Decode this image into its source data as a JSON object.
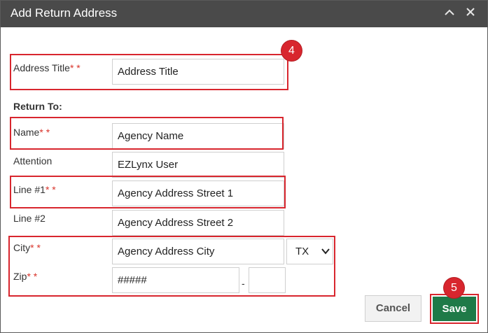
{
  "dialog": {
    "title": "Add Return Address",
    "collapse_icon": "chevron-up-icon",
    "close_icon": "close-icon"
  },
  "form": {
    "address_title": {
      "label": "Address Title",
      "required_mark": "* *",
      "value": "Address Title"
    },
    "section_label": "Return To:",
    "name": {
      "label": "Name",
      "required_mark": "* *",
      "value": "Agency Name"
    },
    "attention": {
      "label": "Attention",
      "value": "EZLynx User"
    },
    "line1": {
      "label": "Line #1",
      "required_mark": "* *",
      "value": "Agency Address Street 1"
    },
    "line2": {
      "label": "Line #2",
      "value": "Agency Address Street 2"
    },
    "city": {
      "label": "City",
      "required_mark": "* *",
      "value": "Agency Address City"
    },
    "state": {
      "value": "TX"
    },
    "zip": {
      "label": "Zip",
      "required_mark": "* *",
      "value": "#####",
      "separator": "-",
      "ext_value": ""
    }
  },
  "buttons": {
    "cancel": "Cancel",
    "save": "Save"
  },
  "annotations": {
    "badge_4": "4",
    "badge_5": "5"
  },
  "colors": {
    "titlebar": "#4a4a4a",
    "highlight": "#d8262e",
    "save": "#1f7a48",
    "required": "#d9342b"
  }
}
